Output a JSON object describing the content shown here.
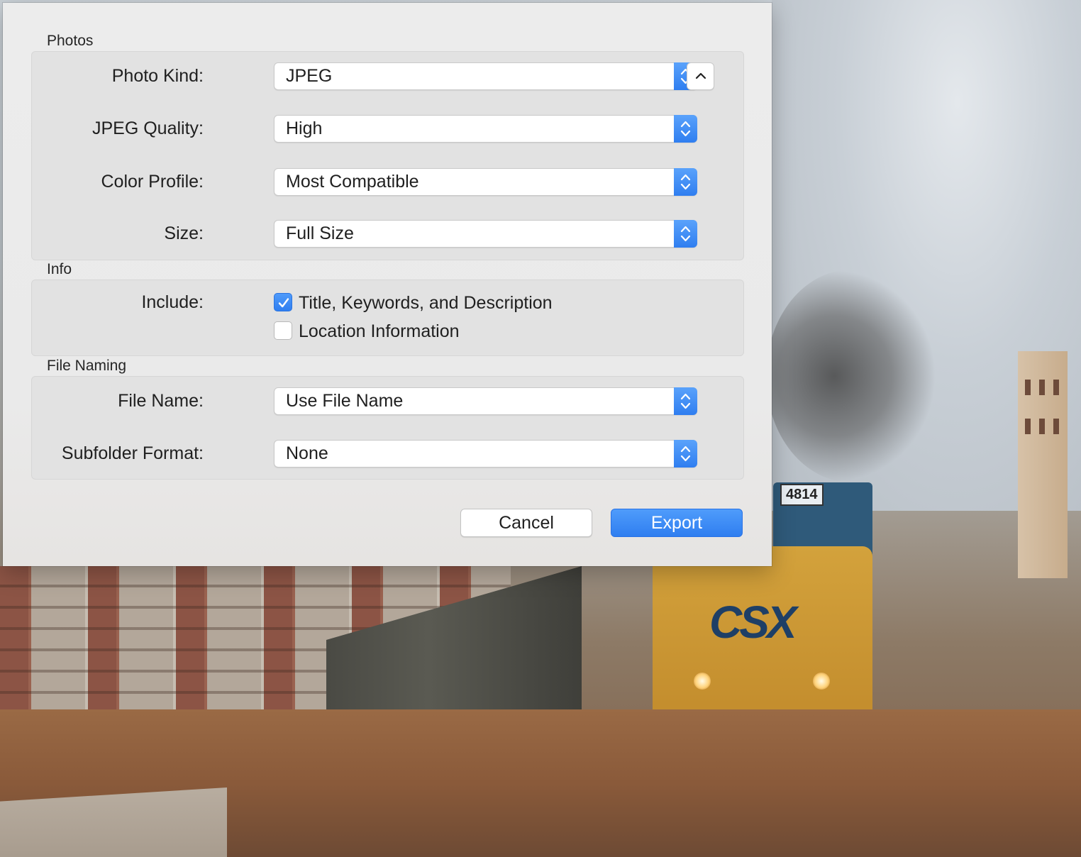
{
  "dialog": {
    "sections": {
      "photos": "Photos",
      "info": "Info",
      "file_naming": "File Naming"
    },
    "photos": {
      "photo_kind_label": "Photo Kind:",
      "photo_kind_value": "JPEG",
      "jpeg_quality_label": "JPEG Quality:",
      "jpeg_quality_value": "High",
      "color_profile_label": "Color Profile:",
      "color_profile_value": "Most Compatible",
      "size_label": "Size:",
      "size_value": "Full Size"
    },
    "info": {
      "include_label": "Include:",
      "options": [
        {
          "label": "Title, Keywords, and Description",
          "checked": true
        },
        {
          "label": "Location Information",
          "checked": false
        }
      ]
    },
    "file_naming": {
      "file_name_label": "File Name:",
      "file_name_value": "Use File Name",
      "subfolder_label": "Subfolder Format:",
      "subfolder_value": "None"
    },
    "buttons": {
      "cancel": "Cancel",
      "export": "Export"
    }
  },
  "background": {
    "locomotive_number": "4814",
    "locomotive_logo": "CSX"
  },
  "colors": {
    "accent": "#2f7ef0",
    "dialog_bg": "#ececec",
    "group_bg": "#e2e2e2"
  },
  "icons": {
    "popup_stepper": "up-down-chevron-icon",
    "disclosure": "chevron-up-icon",
    "checkmark": "checkmark-icon"
  }
}
